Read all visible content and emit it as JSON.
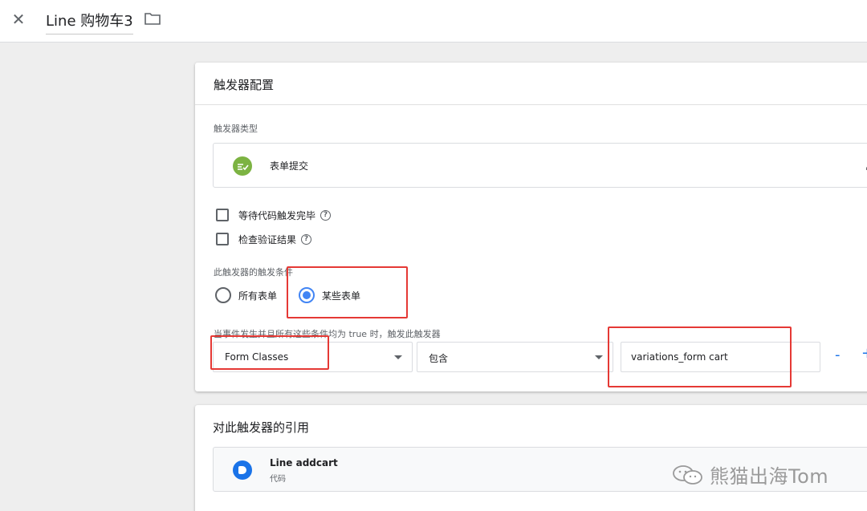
{
  "header": {
    "title": "Line 购物车3",
    "close_icon": "close-icon",
    "folder_icon": "folder-icon"
  },
  "trigger_config": {
    "heading": "触发器配置",
    "type_label": "触发器类型",
    "type_name": "表单提交",
    "type_icon": "form-submit-icon",
    "type_icon_color": "#7cb342",
    "wait_for_tags_label": "等待代码触发完毕",
    "check_validation_label": "检查验证结果",
    "fires_on_label": "此触发器的触发条件",
    "radio_all": "所有表单",
    "radio_some": "某些表单",
    "radio_selected": "某些表单",
    "condition_label": "当事件发生并且所有这些条件均为 true 时，触发此触发器",
    "condition": {
      "variable": "Form Classes",
      "operator": "包含",
      "value": "variations_form cart"
    },
    "minus_label": "-",
    "plus_label": "+"
  },
  "references": {
    "heading": "对此触发器的引用",
    "item_name": "Line addcart",
    "item_type": "代码",
    "item_icon": "tag-icon",
    "item_icon_color": "#1a73e8"
  },
  "watermark": {
    "text": "熊猫出海Tom",
    "icon": "wechat-icon"
  },
  "colors": {
    "accent": "#4285f4",
    "highlight_box": "#e53935"
  }
}
